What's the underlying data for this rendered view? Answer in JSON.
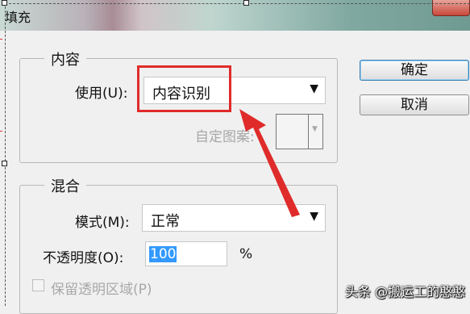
{
  "window": {
    "title": "填充"
  },
  "content_group": {
    "legend": "内容",
    "use_label": "使用(U):",
    "use_value": "内容识别",
    "custom_pattern_label": "自定图案:"
  },
  "blend_group": {
    "legend": "混合",
    "mode_label": "模式(M):",
    "mode_value": "正常",
    "opacity_label": "不透明度(O):",
    "opacity_value": "100",
    "opacity_unit": "%",
    "preserve_transparency_label": "保留透明区域(P)"
  },
  "buttons": {
    "ok": "确定",
    "cancel": "取消"
  },
  "icons": {
    "dropdown": "▼"
  },
  "annotation": {
    "color": "#e02b2b"
  },
  "watermark": "头条 @搬运工的憨憨"
}
